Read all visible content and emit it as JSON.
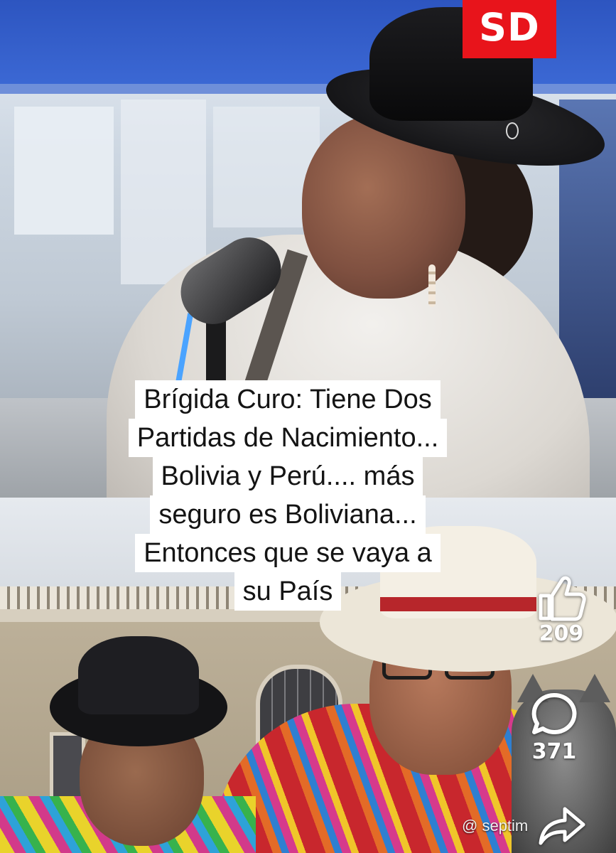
{
  "channel_logo": {
    "text": "SD",
    "color": "#e8141b"
  },
  "caption": {
    "lines": [
      "Brígida Curo: Tiene Dos",
      "Partidas de Nacimiento...",
      "Bolivia y Perú.... más",
      "seguro es Boliviana...",
      "Entonces que se vaya a",
      "su País"
    ]
  },
  "actions": {
    "like": {
      "icon": "thumbs-up-icon",
      "count": "209"
    },
    "comment": {
      "icon": "comment-bubble-icon",
      "count": "371"
    },
    "share": {
      "icon": "share-arrow-icon"
    }
  },
  "watermark": {
    "text": "@ septim"
  }
}
